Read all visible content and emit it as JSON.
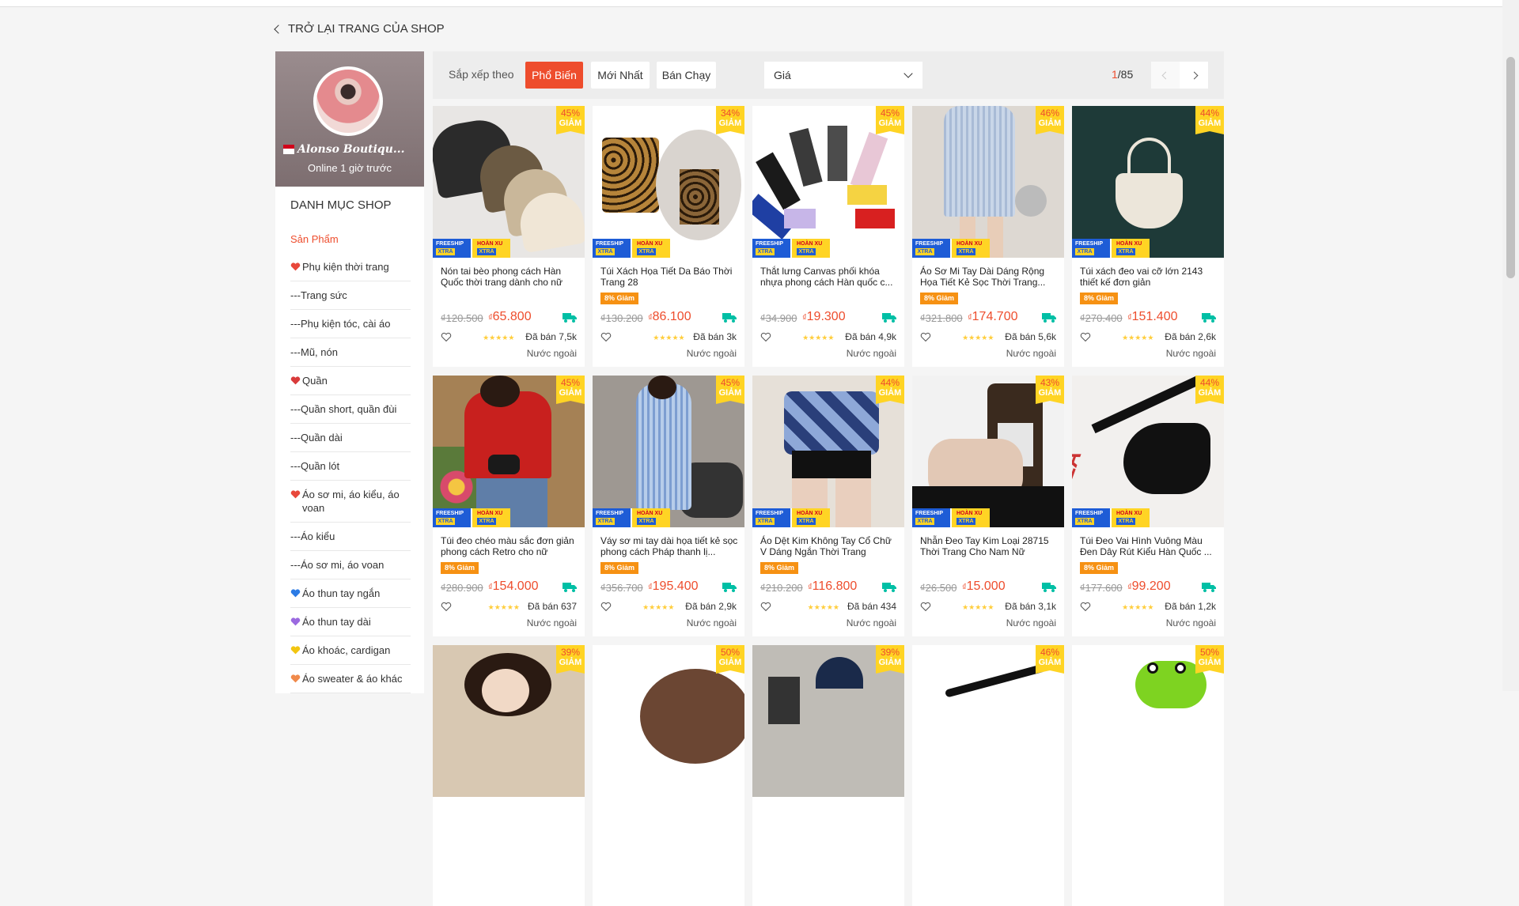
{
  "nav": {
    "back_label": "TRỞ LẠI TRANG CỦA SHOP"
  },
  "shop": {
    "name": "Alonso Boutiqu...",
    "status": "Online 1 giờ trước"
  },
  "categories": {
    "title": "DANH MỤC SHOP",
    "items": [
      {
        "label": "Sản Phẩm",
        "icon": "",
        "active": true
      },
      {
        "label": "Phụ kiện thời trang",
        "icon": "heart-red"
      },
      {
        "label": "---Trang sức",
        "icon": ""
      },
      {
        "label": "---Phụ kiện tóc, cài áo",
        "icon": ""
      },
      {
        "label": "---Mũ, nón",
        "icon": ""
      },
      {
        "label": "Quần",
        "icon": "heart-pin"
      },
      {
        "label": "---Quần short, quần đùi",
        "icon": ""
      },
      {
        "label": "---Quần dài",
        "icon": ""
      },
      {
        "label": "---Quần lót",
        "icon": ""
      },
      {
        "label": "Áo sơ mi, áo kiểu, áo voan",
        "icon": "heart-red"
      },
      {
        "label": "---Áo kiểu",
        "icon": ""
      },
      {
        "label": "---Áo sơ mi, áo voan",
        "icon": ""
      },
      {
        "label": "Áo thun tay ngắn",
        "icon": "heart-blue"
      },
      {
        "label": "Áo thun tay dài",
        "icon": "heart-purple"
      },
      {
        "label": "Áo khoác, cardigan",
        "icon": "heart-yellow"
      },
      {
        "label": "Áo sweater & áo khác",
        "icon": "heart-orange"
      }
    ]
  },
  "sort": {
    "label": "Sắp xếp theo",
    "options": [
      "Phổ Biến",
      "Mới Nhất",
      "Bán Chạy"
    ],
    "active": "Phổ Biến",
    "price_label": "Giá"
  },
  "pagination": {
    "current": "1",
    "total": "/85"
  },
  "badges": {
    "freeship": "FREESHIP",
    "xtra": "XTRA",
    "hoanxu": "HOÀN XU",
    "discount_word": "GIẢM",
    "tag": "8% Giảm"
  },
  "products": [
    {
      "title": "Nón tai bèo phong cách Hàn Quốc thời trang dành cho nữ",
      "discount": "45%",
      "old": "₫120.500",
      "new": "65.800",
      "sold": "Đã bán 7,5k",
      "origin": "Nước ngoài",
      "tag": false,
      "img": "hats"
    },
    {
      "title": "Túi Xách Họa Tiết Da Báo Thời Trang 28",
      "discount": "34%",
      "old": "₫130.200",
      "new": "86.100",
      "sold": "Đã bán 3k",
      "origin": "Nước ngoài",
      "tag": true,
      "img": "leopard"
    },
    {
      "title": "Thắt lưng Canvas phối khóa nhựa phong cách Hàn quốc c...",
      "discount": "45%",
      "old": "₫34.900",
      "new": "19.300",
      "sold": "Đã bán 4,9k",
      "origin": "Nước ngoài",
      "tag": false,
      "img": "belts"
    },
    {
      "title": "Áo Sơ Mi Tay Dài Dáng Rộng Họa Tiết Kẻ Sọc Thời Trang...",
      "discount": "46%",
      "old": "₫321.800",
      "new": "174.700",
      "sold": "Đã bán 5,6k",
      "origin": "Nước ngoài",
      "tag": true,
      "img": "shirt"
    },
    {
      "title": "Túi xách đeo vai cỡ lớn 2143 thiết kế đơn giản",
      "discount": "44%",
      "old": "₫270.400",
      "new": "151.400",
      "sold": "Đã bán 2,6k",
      "origin": "Nước ngoài",
      "tag": true,
      "img": "bag"
    },
    {
      "title": "Túi đeo chéo màu sắc đơn giản phong cách Retro cho nữ",
      "discount": "45%",
      "old": "₫280.900",
      "new": "154.000",
      "sold": "Đã bán 637",
      "origin": "Nước ngoài",
      "tag": true,
      "img": "red"
    },
    {
      "title": "Váy sơ mi tay dài họa tiết kẻ sọc phong cách Pháp thanh lị...",
      "discount": "45%",
      "old": "₫356.700",
      "new": "195.400",
      "sold": "Đã bán 2,9k",
      "origin": "Nước ngoài",
      "tag": true,
      "img": "dress"
    },
    {
      "title": "Áo Dệt Kim Không Tay Cổ Chữ V Dáng Ngắn Thời Trang",
      "discount": "44%",
      "old": "₫210.200",
      "new": "116.800",
      "sold": "Đã bán 434",
      "origin": "Nước ngoài",
      "tag": true,
      "img": "argyle"
    },
    {
      "title": "Nhẫn Đeo Tay Kim Loại 28715 Thời Trang Cho Nam Nữ",
      "discount": "43%",
      "old": "₫26.500",
      "new": "15.000",
      "sold": "Đã bán 3,1k",
      "origin": "Nước ngoài",
      "tag": false,
      "img": "ring"
    },
    {
      "title": "Túi Đeo Vai Hình Vuông Màu Đen Dây Rút Kiểu Hàn Quốc ...",
      "discount": "44%",
      "old": "₫177.600",
      "new": "99.200",
      "sold": "Đã bán 1,2k",
      "origin": "Nước ngoài",
      "tag": true,
      "img": "blackbag"
    },
    {
      "title": "",
      "discount": "39%",
      "partial": true,
      "img": "girl"
    },
    {
      "title": "",
      "discount": "50%",
      "partial": true,
      "img": "hair"
    },
    {
      "title": "",
      "discount": "39%",
      "partial": true,
      "img": "cap"
    },
    {
      "title": "",
      "discount": "46%",
      "partial": true,
      "img": "strap"
    },
    {
      "title": "",
      "discount": "50%",
      "partial": true,
      "img": "frog"
    }
  ],
  "colors": {
    "accent": "#ee4d2d",
    "badge_yellow": "#ffd424",
    "freeship_blue": "#1e5cd6",
    "tag_orange": "#f69113"
  }
}
